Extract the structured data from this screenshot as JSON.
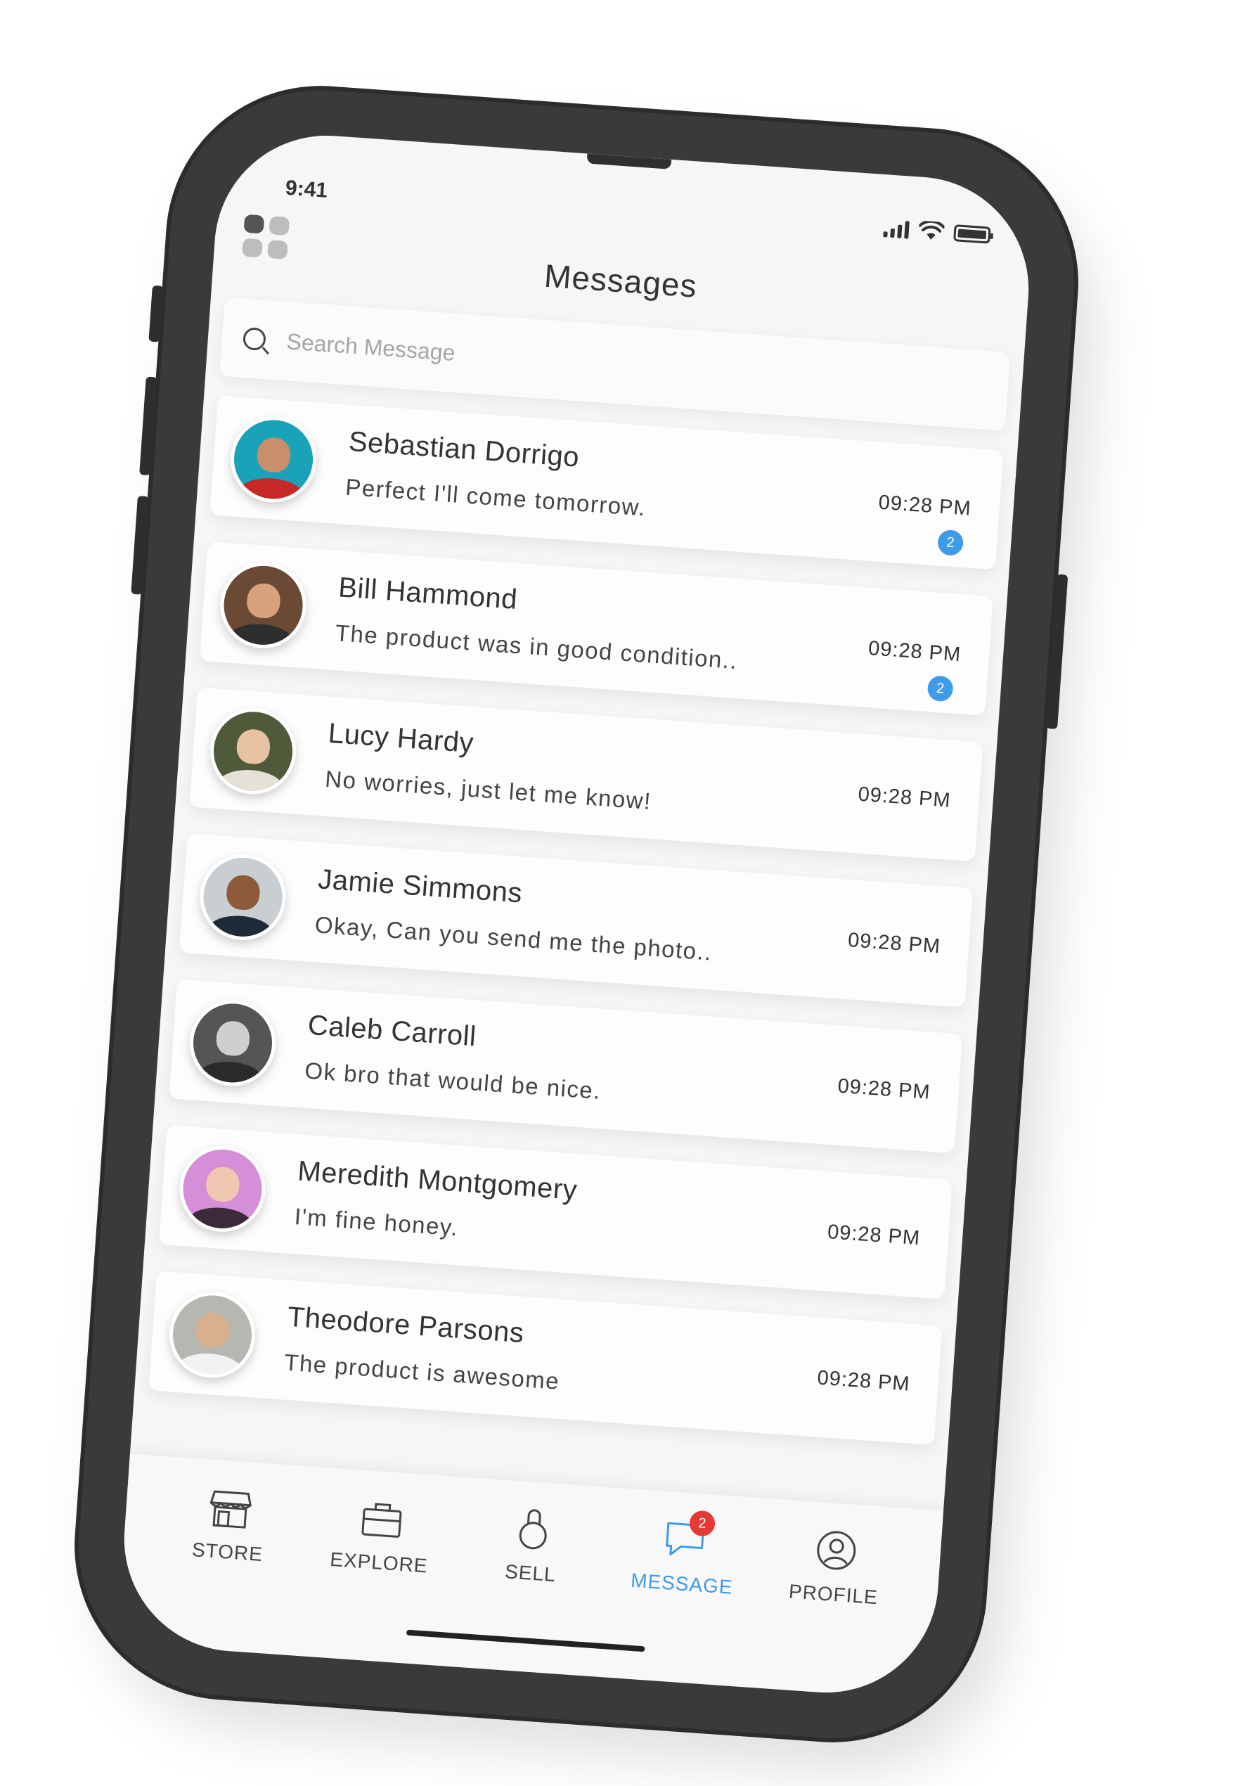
{
  "status_bar": {
    "time": "9:41"
  },
  "header": {
    "title": "Messages"
  },
  "search": {
    "placeholder": "Search Message"
  },
  "conversations": [
    {
      "name": "Sebastian Dorrigo",
      "message": "Perfect I'll come tomorrow.",
      "time": "09:28 PM",
      "unread": "2",
      "avatar_colors": {
        "bg": "#1aa3b8",
        "skin": "#c98f6b",
        "shirt": "#c62828"
      }
    },
    {
      "name": "Bill Hammond",
      "message": "The product was in good condition..",
      "time": "09:28 PM",
      "unread": "2",
      "avatar_colors": {
        "bg": "#6b4a35",
        "skin": "#d9a27d",
        "shirt": "#2e2e2e"
      }
    },
    {
      "name": "Lucy Hardy",
      "message": "No worries, just let me know!",
      "time": "09:28 PM",
      "unread": "",
      "avatar_colors": {
        "bg": "#4e5a3a",
        "skin": "#e8c3a3",
        "shirt": "#e6e1d6"
      }
    },
    {
      "name": "Jamie Simmons",
      "message": "Okay, Can you send me the photo..",
      "time": "09:28 PM",
      "unread": "",
      "avatar_colors": {
        "bg": "#c9ced3",
        "skin": "#8d5a3b",
        "shirt": "#1f2a38"
      }
    },
    {
      "name": "Caleb Carroll",
      "message": "Ok bro that would be nice.",
      "time": "09:28 PM",
      "unread": "",
      "avatar_colors": {
        "bg": "#555555",
        "skin": "#cfcfcf",
        "shirt": "#2a2a2a"
      }
    },
    {
      "name": "Meredith Montgomery",
      "message": "I'm fine honey.",
      "time": "09:28 PM",
      "unread": "",
      "avatar_colors": {
        "bg": "#d58fd8",
        "skin": "#f0c7b0",
        "shirt": "#3a2a3a"
      }
    },
    {
      "name": "Theodore Parsons",
      "message": "The product is awesome",
      "time": "09:28 PM",
      "unread": "",
      "avatar_colors": {
        "bg": "#b7b7b2",
        "skin": "#d8b08e",
        "shirt": "#f2f2f2"
      }
    }
  ],
  "bottom_nav": {
    "items": [
      {
        "label": "STORE",
        "icon": "store-icon"
      },
      {
        "label": "EXPLORE",
        "icon": "briefcase-icon"
      },
      {
        "label": "SELL",
        "icon": "sell-tag-icon"
      },
      {
        "label": "MESSAGE",
        "icon": "message-bubble-icon",
        "badge": "2",
        "active": true
      },
      {
        "label": "PROFILE",
        "icon": "profile-icon"
      }
    ]
  },
  "colors": {
    "accent": "#3d9be9",
    "badge_alert": "#e53935",
    "frame": "#3a3a3a"
  }
}
